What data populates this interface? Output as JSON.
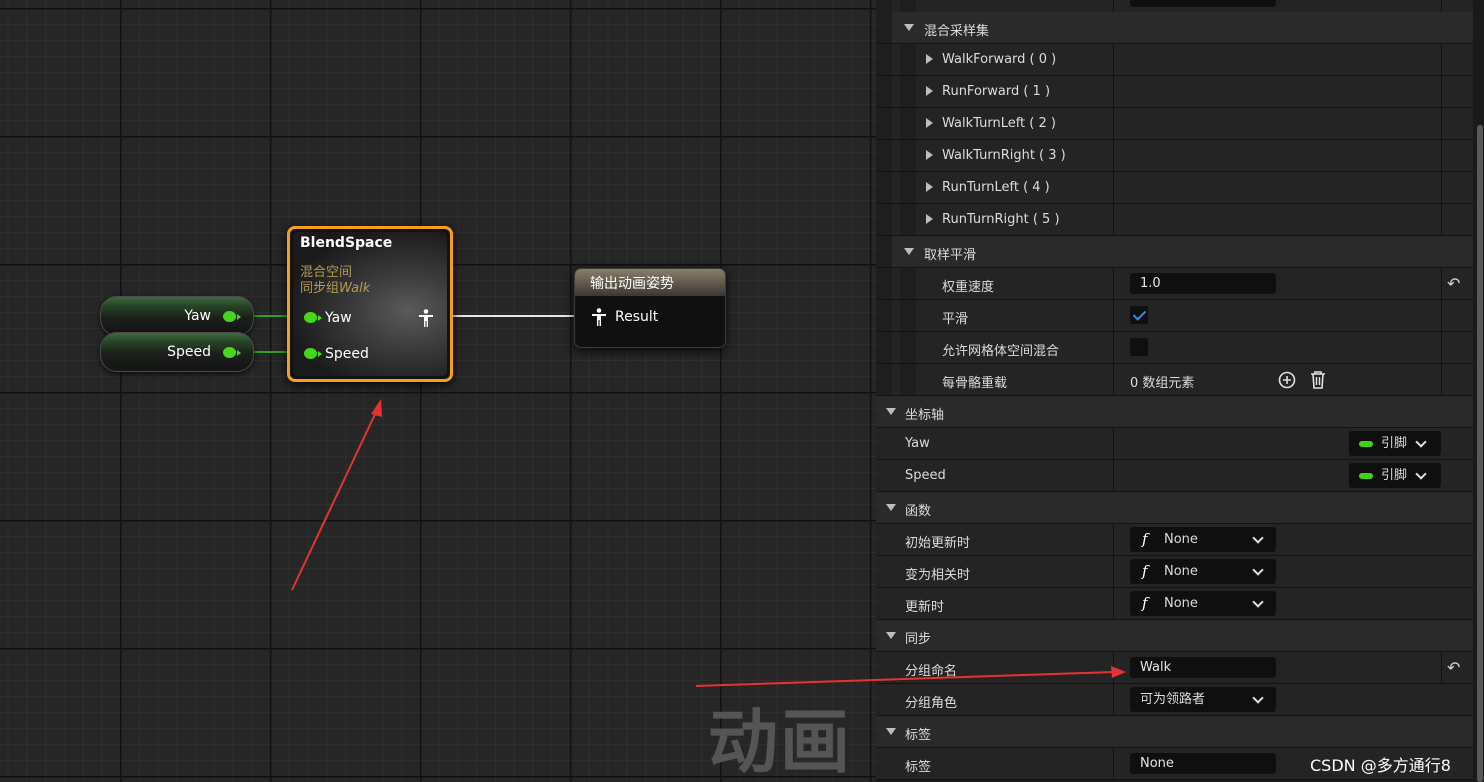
{
  "graph": {
    "yaw_var": "Yaw",
    "speed_var": "Speed",
    "blendspace_node": {
      "title": "BlendSpace",
      "subtitle": "混合空间",
      "sync_group": "同步组",
      "sync_group_name": "Walk",
      "pin_yaw": "Yaw",
      "pin_speed": "Speed"
    },
    "output_node": {
      "title": "输出动画姿势",
      "pin": "Result"
    },
    "watermark": "动画",
    "pin_color": "#46d71a",
    "selection_color": "#f4a019"
  },
  "panel": {
    "blend_samples": {
      "label": "混合采样集",
      "items": [
        "WalkForward ( 0 )",
        "RunForward ( 1 )",
        "WalkTurnLeft ( 2 )",
        "WalkTurnRight ( 3 )",
        "RunTurnLeft ( 4 )",
        "RunTurnRight ( 5 )"
      ]
    },
    "sample_smoothing": {
      "label": "取样平滑",
      "weight_speed_label": "权重速度",
      "weight_speed_value": "1.0",
      "smooth_label": "平滑",
      "smooth_checked": true,
      "grid_blend_label": "允许网格体空间混合",
      "grid_blend_checked": false,
      "per_bone_label": "每骨骼重载",
      "per_bone_value": "0 数组元素"
    },
    "axes": {
      "label": "坐标轴",
      "yaw_label": "Yaw",
      "yaw_value": "引脚",
      "speed_label": "Speed",
      "speed_value": "引脚"
    },
    "functions": {
      "label": "函数",
      "initial_update_label": "初始更新时",
      "initial_update_value": "None",
      "become_relevant_label": "变为相关时",
      "become_relevant_value": "None",
      "update_label": "更新时",
      "update_value": "None"
    },
    "sync": {
      "label": "同步",
      "group_name_label": "分组命名",
      "group_name_value": "Walk",
      "group_role_label": "分组角色",
      "group_role_value": "可为领路者"
    },
    "tags": {
      "label": "标签",
      "tag_label": "标签",
      "tag_value": "None"
    }
  },
  "footer": {
    "credit": "CSDN @多方通行8"
  }
}
